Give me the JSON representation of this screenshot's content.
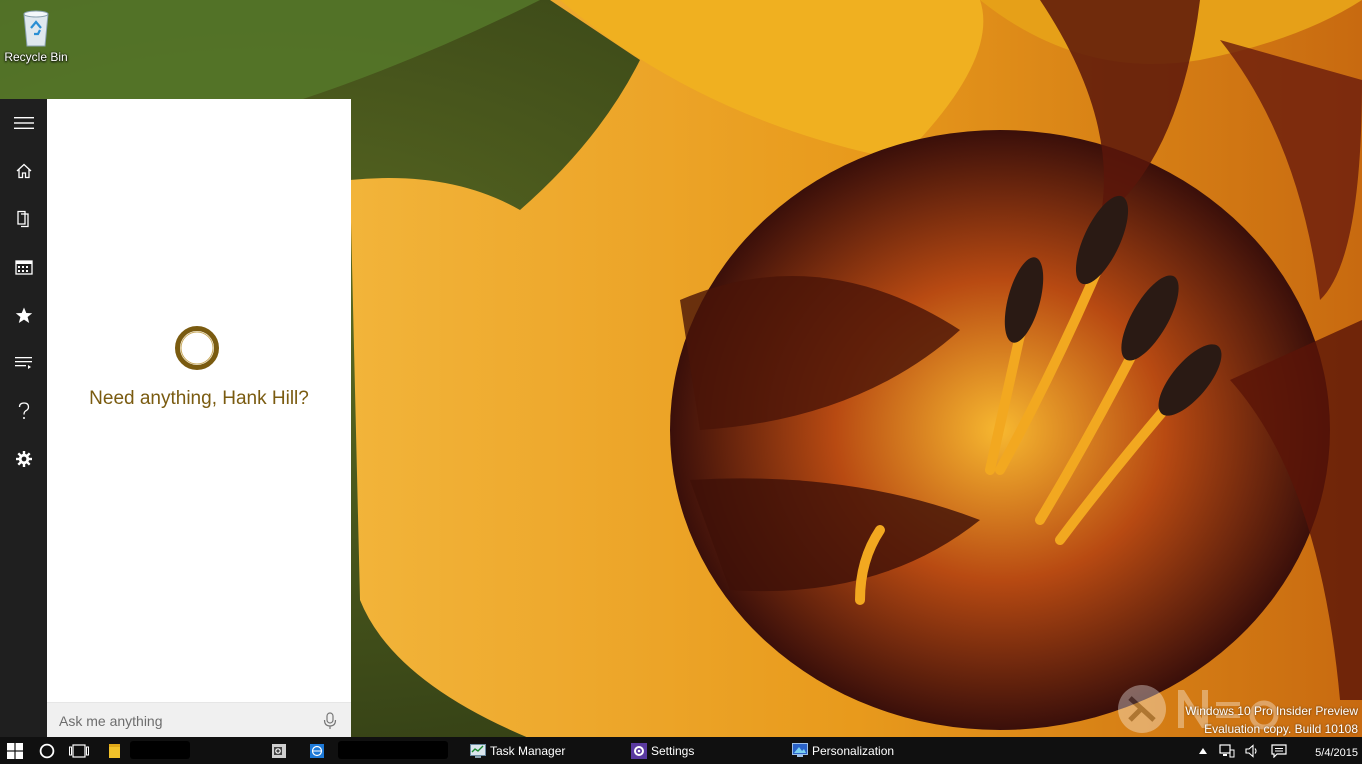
{
  "desktop": {
    "icons": [
      {
        "label": "Recycle Bin",
        "icon": "recycle-bin-icon"
      }
    ]
  },
  "cortana": {
    "greeting": "Need anything, Hank Hill?",
    "search_placeholder": "Ask me anything",
    "accent_color": "#7a5b10",
    "rail_icons": [
      "hamburger-menu-icon",
      "home-icon",
      "notebook-icon",
      "calendar-icon",
      "star-icon",
      "list-icon",
      "help-icon",
      "gear-icon"
    ]
  },
  "watermark": {
    "line1": "Windows 10 Pro Insider Preview",
    "line2": "Evaluation copy. Build 10108"
  },
  "taskbar": {
    "apps": [
      {
        "label": "Task Manager",
        "icon": "task-manager-icon"
      },
      {
        "label": "Settings",
        "icon": "settings-icon"
      },
      {
        "label": "Personalization",
        "icon": "personalization-icon"
      }
    ],
    "clock_date": "5/4/2015"
  }
}
